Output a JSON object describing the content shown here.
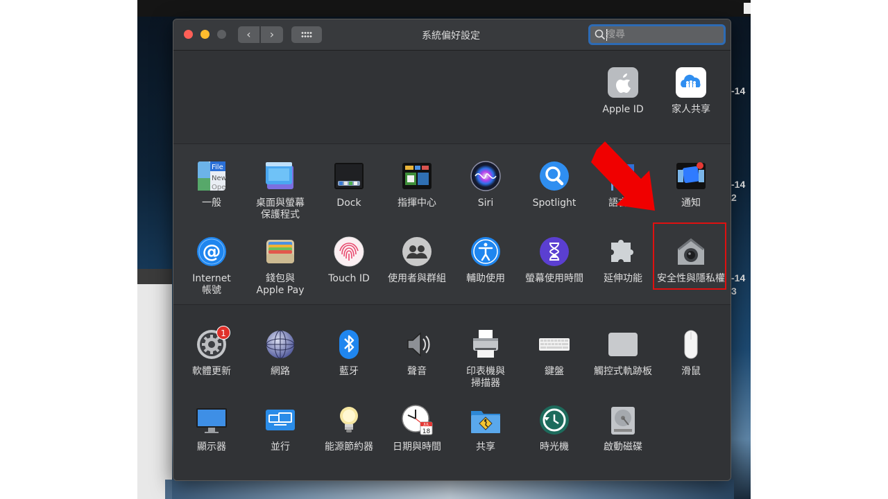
{
  "window": {
    "title": "系統偏好設定"
  },
  "search": {
    "placeholder": "搜尋",
    "value": ""
  },
  "desktop_side": [
    "-14",
    "-14",
    "2",
    "-14",
    "3"
  ],
  "account_prefs": [
    {
      "label": "Apple ID",
      "icon": "apple-logo-icon"
    },
    {
      "label": "家人共享",
      "icon": "family-sharing-icon"
    }
  ],
  "personal_prefs": [
    {
      "label": "一般",
      "icon": "general-icon"
    },
    {
      "label": "桌面與螢幕\n保護程式",
      "icon": "desktop-screensaver-icon"
    },
    {
      "label": "Dock",
      "icon": "dock-icon"
    },
    {
      "label": "指揮中心",
      "icon": "mission-control-icon"
    },
    {
      "label": "Siri",
      "icon": "siri-icon"
    },
    {
      "label": "Spotlight",
      "icon": "spotlight-icon"
    },
    {
      "label": "語言與",
      "icon": "language-region-icon"
    },
    {
      "label": "通知",
      "icon": "notifications-icon"
    },
    {
      "label": "Internet\n帳號",
      "icon": "internet-accounts-icon"
    },
    {
      "label": "錢包與\nApple Pay",
      "icon": "wallet-icon"
    },
    {
      "label": "Touch ID",
      "icon": "fingerprint-icon"
    },
    {
      "label": "使用者與群組",
      "icon": "users-groups-icon"
    },
    {
      "label": "輔助使用",
      "icon": "accessibility-icon"
    },
    {
      "label": "螢幕使用時間",
      "icon": "screen-time-icon"
    },
    {
      "label": "延伸功能",
      "icon": "extensions-icon"
    },
    {
      "label": "安全性與隱私權",
      "icon": "security-privacy-icon"
    }
  ],
  "hardware_prefs": [
    {
      "label": "軟體更新",
      "icon": "software-update-icon",
      "badge": "1"
    },
    {
      "label": "網路",
      "icon": "network-icon"
    },
    {
      "label": "藍牙",
      "icon": "bluetooth-icon"
    },
    {
      "label": "聲音",
      "icon": "sound-icon"
    },
    {
      "label": "印表機與\n掃描器",
      "icon": "printer-icon"
    },
    {
      "label": "鍵盤",
      "icon": "keyboard-icon"
    },
    {
      "label": "觸控式軌跡板",
      "icon": "trackpad-icon"
    },
    {
      "label": "滑鼠",
      "icon": "mouse-icon"
    },
    {
      "label": "顯示器",
      "icon": "display-icon"
    },
    {
      "label": "並行",
      "icon": "sidecar-icon"
    },
    {
      "label": "能源節約器",
      "icon": "energy-saver-icon"
    },
    {
      "label": "日期與時間",
      "icon": "date-time-icon"
    },
    {
      "label": "共享",
      "icon": "sharing-icon"
    },
    {
      "label": "時光機",
      "icon": "time-machine-icon"
    },
    {
      "label": "啟動磁碟",
      "icon": "startup-disk-icon"
    }
  ],
  "calendar": {
    "month": "JUL",
    "day": "18"
  },
  "annotation": {
    "color": "#e01010"
  }
}
